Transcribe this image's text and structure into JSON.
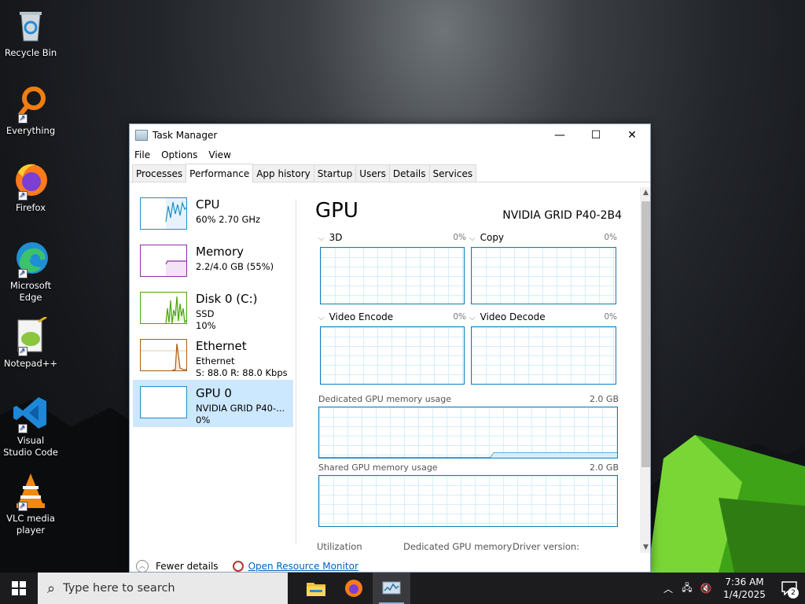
{
  "desktop": {
    "icons": [
      {
        "label": "Recycle Bin",
        "icon": "recycle-bin-icon"
      },
      {
        "label": "Everything",
        "icon": "everything-search-icon"
      },
      {
        "label": "Firefox",
        "icon": "firefox-icon"
      },
      {
        "label": "Microsoft Edge",
        "icon": "edge-icon"
      },
      {
        "label": "Notepad++",
        "icon": "notepad-plus-plus-icon"
      },
      {
        "label": "Visual Studio Code",
        "icon": "vscode-icon"
      },
      {
        "label": "VLC media player",
        "icon": "vlc-icon"
      }
    ]
  },
  "window": {
    "title": "Task Manager",
    "menu": [
      "File",
      "Options",
      "View"
    ],
    "tabs": [
      "Processes",
      "Performance",
      "App history",
      "Startup",
      "Users",
      "Details",
      "Services"
    ],
    "active_tab": "Performance"
  },
  "sidebar": {
    "items": [
      {
        "name": "CPU",
        "sub1": "60%  2.70 GHz",
        "sub2": "",
        "color": "#1d8dc8"
      },
      {
        "name": "Memory",
        "sub1": "2.2/4.0 GB (55%)",
        "sub2": "",
        "color": "#8b2fa8"
      },
      {
        "name": "Disk 0 (C:)",
        "sub1": "SSD",
        "sub2": "10%",
        "color": "#4da60c"
      },
      {
        "name": "Ethernet",
        "sub1": "Ethernet",
        "sub2": "S: 88.0  R: 88.0 Kbps",
        "color": "#a75d10"
      },
      {
        "name": "GPU 0",
        "sub1": "NVIDIA GRID P40-...",
        "sub2": "0%",
        "color": "#1d8dc8",
        "selected": true
      }
    ]
  },
  "main": {
    "title": "GPU",
    "model": "NVIDIA GRID P40-2B4",
    "engines": [
      {
        "label": "3D",
        "pct": "0%"
      },
      {
        "label": "Copy",
        "pct": "0%"
      },
      {
        "label": "Video Encode",
        "pct": "0%"
      },
      {
        "label": "Video Decode",
        "pct": "0%"
      }
    ],
    "dedicated_label": "Dedicated GPU memory usage",
    "dedicated_max": "2.0 GB",
    "shared_label": "Shared GPU memory usage",
    "shared_max": "2.0 GB",
    "stats": [
      "Utilization",
      "Dedicated GPU memory",
      "Driver version:"
    ]
  },
  "bottom": {
    "fewer_details": "Fewer details",
    "resource_monitor": "Open Resource Monitor"
  },
  "taskbar": {
    "search_placeholder": "Type here to search",
    "time": "7:36 AM",
    "date": "1/4/2025",
    "notification_count": "2"
  }
}
